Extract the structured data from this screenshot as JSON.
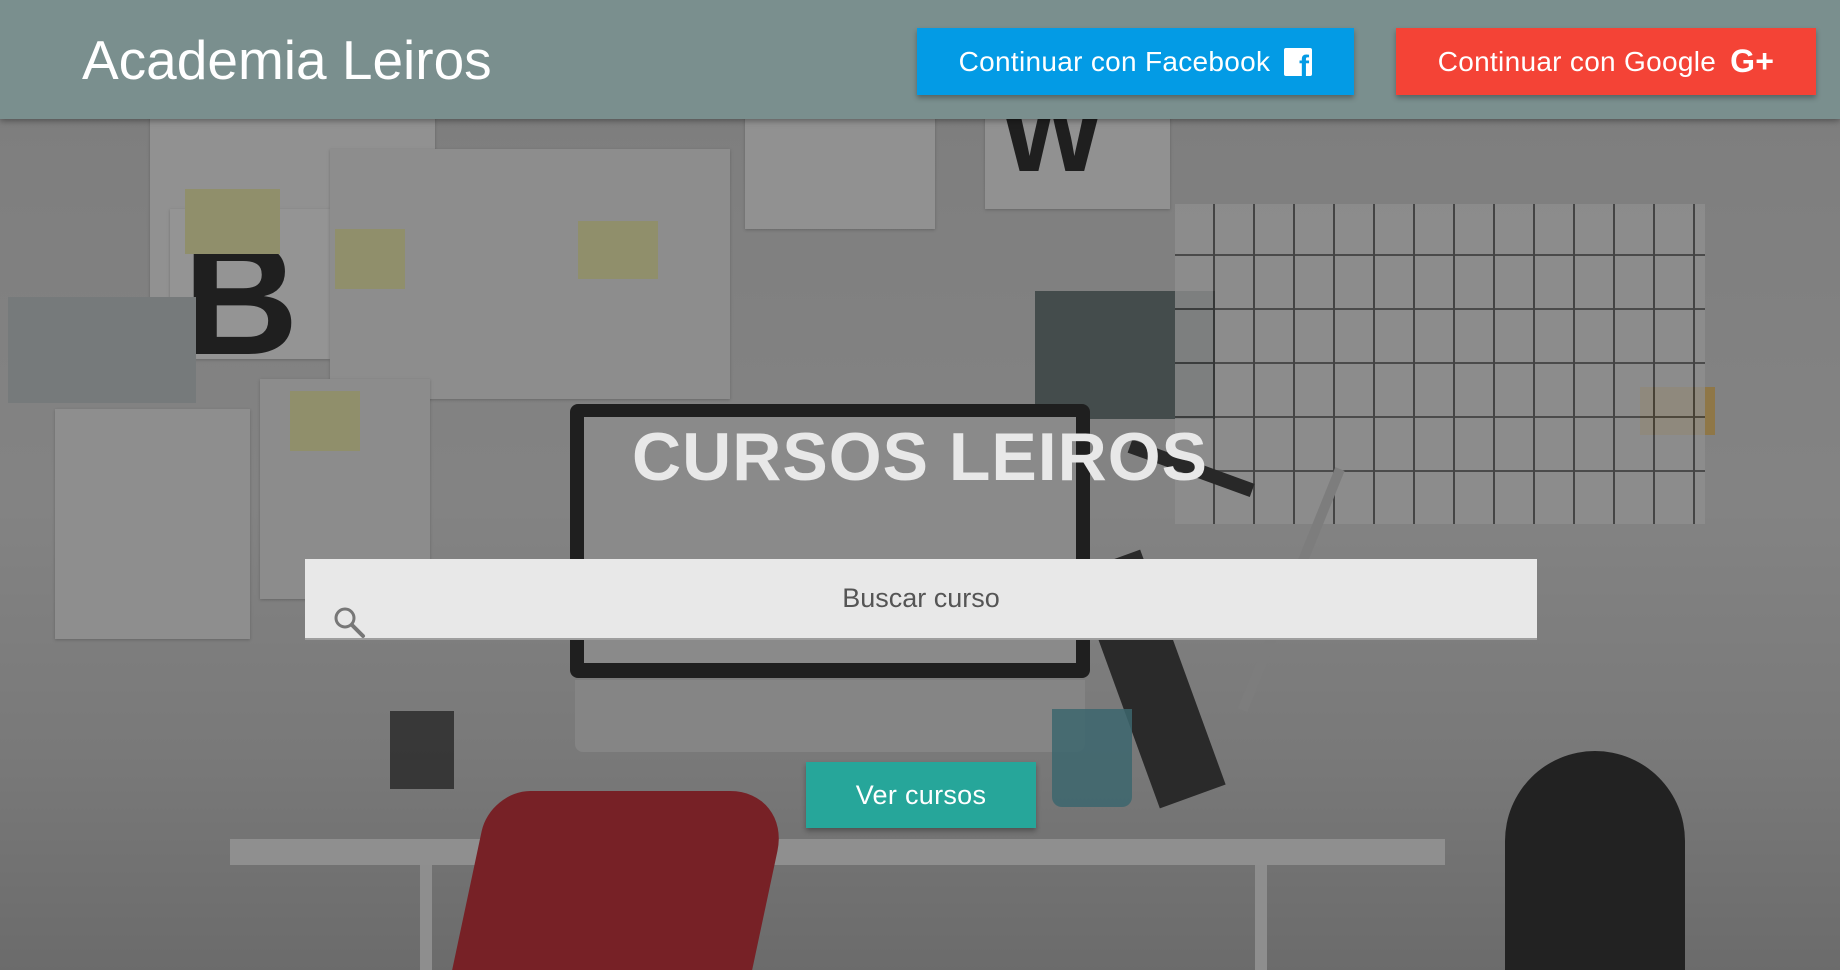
{
  "navbar": {
    "brand": "Academia Leiros",
    "facebook_button": {
      "label": "Continuar con Facebook",
      "icon": "facebook-icon",
      "color": "#039be5"
    },
    "google_button": {
      "label": "Continuar con Google",
      "icon": "google-plus-icon",
      "icon_glyph": "G+",
      "color": "#f44336"
    },
    "background_color": "#7a8f8e"
  },
  "hero": {
    "title": "CURSOS LEIROS",
    "search": {
      "placeholder": "Buscar curso",
      "value": "",
      "icon": "search-icon"
    },
    "cta_button": {
      "label": "Ver cursos",
      "color": "#26a69a"
    },
    "background_image": "desk workspace photo with monitor, lamp, red chair, pinned papers"
  }
}
